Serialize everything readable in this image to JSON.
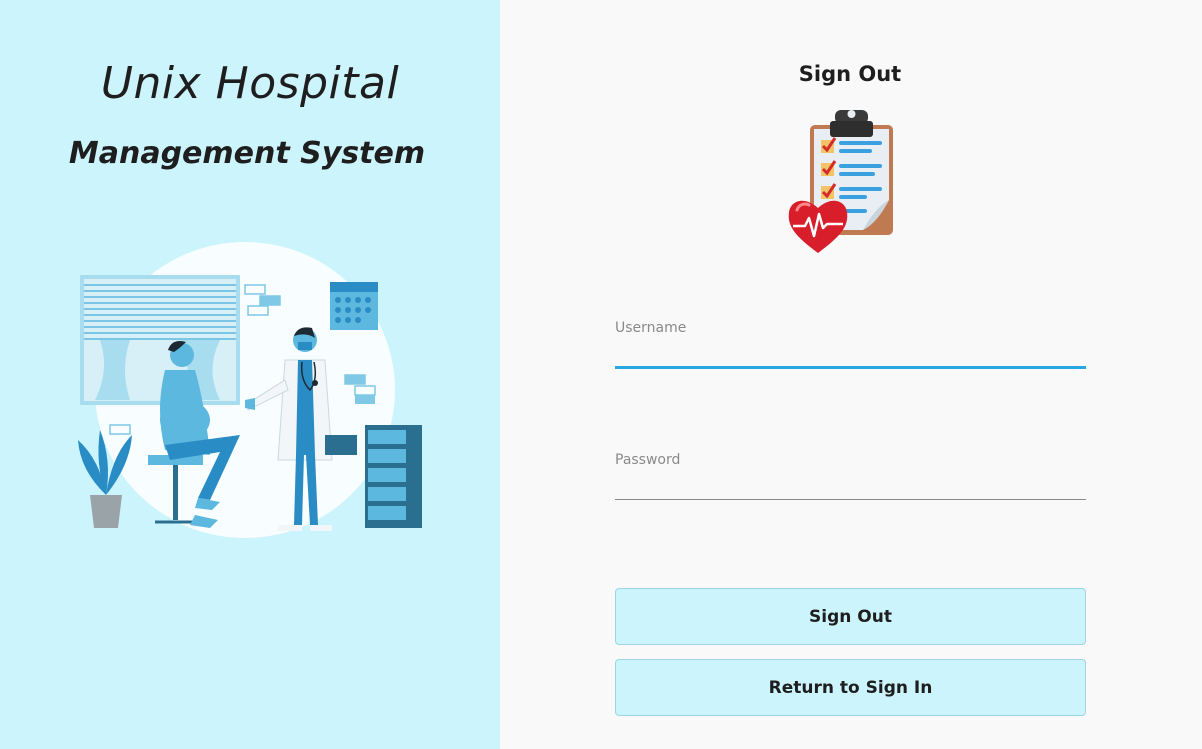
{
  "brand": {
    "title": "Unix Hospital",
    "subtitle": "Management System"
  },
  "form": {
    "title": "Sign Out",
    "username": {
      "label": "Username",
      "value": ""
    },
    "password": {
      "label": "Password",
      "value": ""
    },
    "sign_out_button": "Sign Out",
    "return_button": "Return to Sign In"
  },
  "colors": {
    "left_panel_bg": "#ccf4fc",
    "accent": "#29a8e0",
    "button_bg": "#ccf4fc",
    "text": "#1e1e1e"
  },
  "icons": {
    "logo": "clipboard-heart-icon",
    "illustration": "doctor-patient-illustration"
  }
}
